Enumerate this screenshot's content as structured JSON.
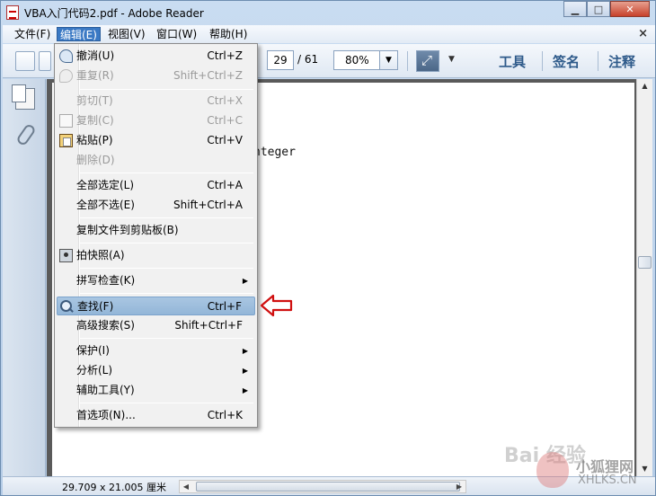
{
  "window": {
    "title": "VBA入门代码2.pdf - Adobe Reader"
  },
  "menubar": {
    "items": [
      "文件(F)",
      "编辑(E)",
      "视图(V)",
      "窗口(W)",
      "帮助(H)"
    ],
    "close": "×"
  },
  "toolbar": {
    "page_current": "29",
    "page_total": "/ 61",
    "zoom": "80%",
    "tools_label": "工具",
    "sign_label": "签名",
    "comment_label": "注释"
  },
  "document": {
    "fragment": "nteger"
  },
  "status": {
    "page_size": "29.709 x 21.005 厘米"
  },
  "edit_menu": {
    "undo": {
      "label": "撤消(U)",
      "shortcut": "Ctrl+Z"
    },
    "redo": {
      "label": "重复(R)",
      "shortcut": "Shift+Ctrl+Z"
    },
    "cut": {
      "label": "剪切(T)",
      "shortcut": "Ctrl+X"
    },
    "copy": {
      "label": "复制(C)",
      "shortcut": "Ctrl+C"
    },
    "paste": {
      "label": "粘贴(P)",
      "shortcut": "Ctrl+V"
    },
    "delete": {
      "label": "删除(D)"
    },
    "select_all": {
      "label": "全部选定(L)",
      "shortcut": "Ctrl+A"
    },
    "deselect_all": {
      "label": "全部不选(E)",
      "shortcut": "Shift+Ctrl+A"
    },
    "copy_file": {
      "label": "复制文件到剪贴板(B)"
    },
    "snapshot": {
      "label": "拍快照(A)"
    },
    "spellcheck": {
      "label": "拼写检查(K)"
    },
    "find": {
      "label": "查找(F)",
      "shortcut": "Ctrl+F"
    },
    "advanced_search": {
      "label": "高级搜索(S)",
      "shortcut": "Shift+Ctrl+F"
    },
    "protect": {
      "label": "保护(I)"
    },
    "analyze": {
      "label": "分析(L)"
    },
    "accessibility": {
      "label": "辅助工具(Y)"
    },
    "preferences": {
      "label": "首选项(N)...",
      "shortcut": "Ctrl+K"
    }
  },
  "watermark": {
    "baidu": "Bai 经验",
    "brand": "小狐狸网",
    "url": "XHLKS.CN"
  },
  "colors": {
    "menu_highlight": "#3a79c4",
    "annotation_arrow": "#d01010"
  }
}
